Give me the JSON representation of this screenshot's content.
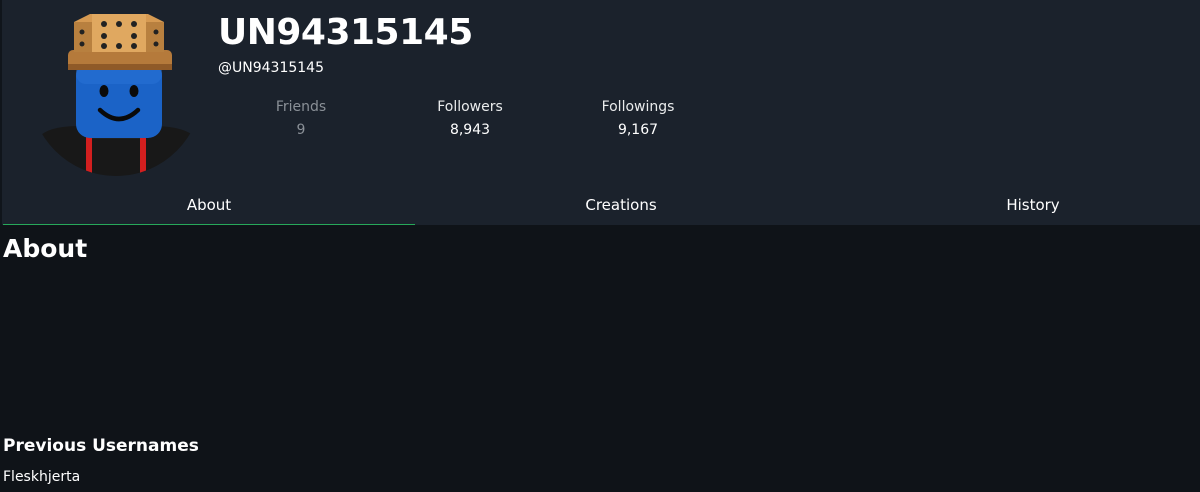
{
  "profile": {
    "display_name": "UN94315145",
    "handle": "@UN94315145",
    "avatar": "roblox-avatar-crown"
  },
  "stats": [
    {
      "label": "Friends",
      "value": "9"
    },
    {
      "label": "Followers",
      "value": "8,943"
    },
    {
      "label": "Followings",
      "value": "9,167"
    }
  ],
  "tabs": [
    {
      "label": "About"
    },
    {
      "label": "Creations"
    },
    {
      "label": "History"
    }
  ],
  "about": {
    "title": "About",
    "previous_usernames_title": "Previous Usernames",
    "previous_usernames": [
      "Fleskhjerta"
    ]
  },
  "colors": {
    "header_bg": "#1b222c",
    "page_bg": "#0f1318",
    "active_tab_underline": "#27a85a"
  }
}
